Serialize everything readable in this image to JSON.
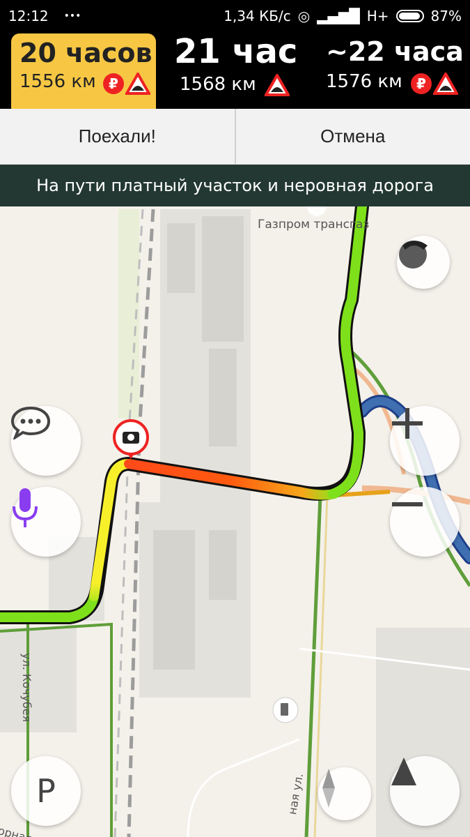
{
  "status": {
    "time": "12:12",
    "speed": "1,34 КБ/с",
    "network": "H+",
    "battery": "87%",
    "dots": "•••"
  },
  "routes": [
    {
      "duration": "20 часов",
      "distance": "1556 км",
      "selected": true,
      "toll": true,
      "rough_road": true
    },
    {
      "duration": "21 час",
      "distance": "1568 км",
      "selected": false,
      "toll": false,
      "rough_road": true
    },
    {
      "duration": "~22 часа",
      "distance": "1576 км",
      "selected": false,
      "toll": true,
      "rough_road": true
    }
  ],
  "actions": {
    "go": "Поехали!",
    "cancel": "Отмена"
  },
  "notice": "На пути платный участок и неровная дорога",
  "map": {
    "poi_label": "Газпром трансгаз",
    "street1": "ул. Кочубея",
    "street2": "ная ул.",
    "street3": "орная ул."
  },
  "icons": {
    "ruble": "₽",
    "layers": "layers-icon",
    "chat": "chat-icon",
    "mic": "microphone-icon",
    "parking": "P",
    "compass": "compass-icon",
    "navigate": "navigation-arrow-icon"
  },
  "colors": {
    "selected_route": "#f7c744",
    "notice_bg": "#233832",
    "mic": "#8a3df0"
  }
}
